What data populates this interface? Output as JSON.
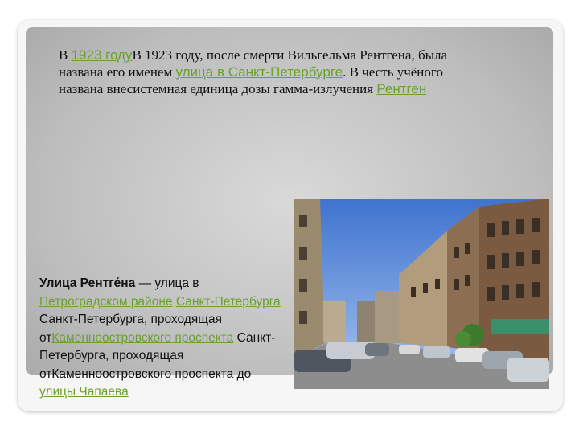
{
  "top": {
    "prefix": "В ",
    "link1": "1923 году",
    "text1": "В 1923 году, после смерти Вильгельма Рентгена, была названа его именем ",
    "link2": "улица в Санкт-Петербурге",
    "text2": ". В честь учёного названа внесистемная единица дозы гамма-излучения ",
    "link3": "Рентген"
  },
  "photo": {
    "icon": "street-photo"
  },
  "bottom": {
    "title": "Улица Рентге́на",
    "t1": " — улица в ",
    "link1": "Петроградском районе",
    "t2": " ",
    "link2": "Санкт-Петербурга",
    "t3": " Санкт-Петербурга, проходящая от",
    "link3": "Каменноостровского проспекта",
    "t4": " Санкт-Петербурга, проходящая отКаменноостровского проспекта до ",
    "link4": "улицы Чапаева"
  }
}
